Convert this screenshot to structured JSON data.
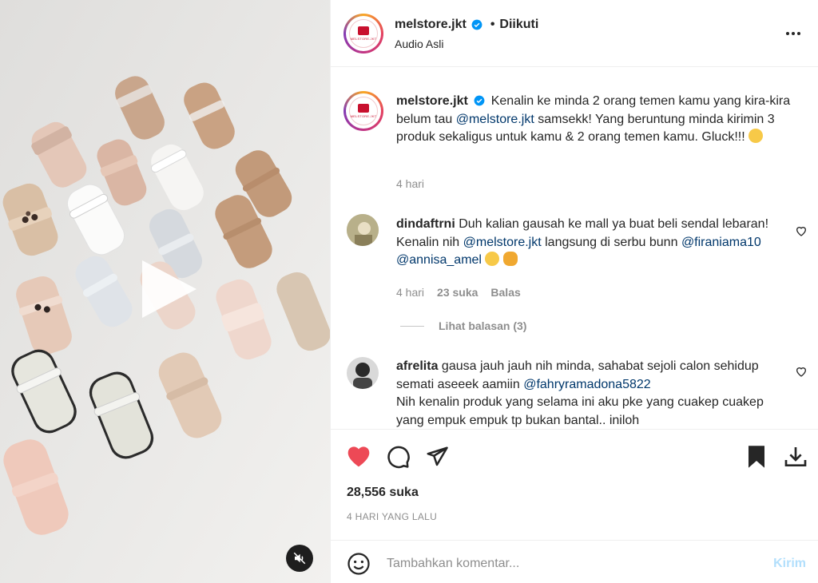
{
  "header": {
    "username": "melstore.jkt",
    "separator": "•",
    "follow_status": "Diikuti",
    "audio": "Audio Asli",
    "logo_text": "MELSTORE.JKT"
  },
  "caption": {
    "username": "melstore.jkt",
    "text_1": "Kenalin ke minda 2 orang temen kamu yang kira-kira belum tau",
    "mention": "@melstore.jkt",
    "text_2": "samsekk! Yang beruntung minda kirimin 3 produk sekaligus untuk kamu & 2 orang temen kamu. Gluck!!!",
    "time": "4 hari"
  },
  "comments": [
    {
      "username": "dindaftrni",
      "text_1": "Duh kalian gausah ke mall ya buat beli sendal lebaran! Kenalin nih",
      "mention_1": "@melstore.jkt",
      "text_2": "langsung di serbu bunn",
      "mention_2": "@firaniama10",
      "mention_3": "@annisa_amel",
      "time": "4 hari",
      "likes": "23 suka",
      "reply": "Balas",
      "view_replies": "Lihat balasan (3)"
    },
    {
      "username": "afrelita",
      "text_1": "gausa jauh jauh nih minda, sahabat sejoli calon sehidup semati aseeek aamiin",
      "mention_1": "@fahryramadona5822",
      "text_2": "Nih kenalin produk yang selama ini aku pke yang cuakep cuakep yang empuk empuk tp bukan bantal.. iniloh"
    }
  ],
  "actions": {
    "likes": "28,556 suka",
    "date": "4 HARI YANG LALU"
  },
  "add_comment": {
    "placeholder": "Tambahkan komentar...",
    "post_label": "Kirim"
  },
  "colors": {
    "like_red": "#ed4956",
    "link_blue": "#00376b",
    "verified_blue": "#0095f6",
    "post_disabled": "#b2dffc"
  }
}
